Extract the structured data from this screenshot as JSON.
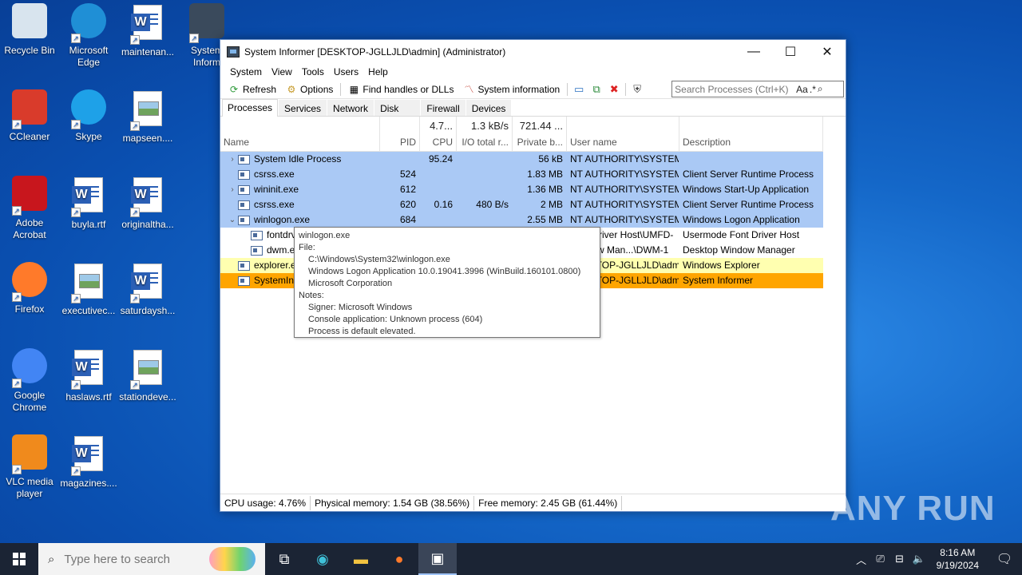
{
  "desktop": {
    "icons": [
      {
        "label": "Recycle Bin",
        "icon": "recycle-bin-icon"
      },
      {
        "label": "Microsoft Edge",
        "icon": "edge-icon"
      },
      {
        "label": "maintenan...",
        "icon": "word-doc-icon"
      },
      {
        "label": "System Inform",
        "icon": "system-informer-icon"
      },
      {
        "label": "CCleaner",
        "icon": "ccleaner-icon"
      },
      {
        "label": "Skype",
        "icon": "skype-icon"
      },
      {
        "label": "mapseen....",
        "icon": "image-doc-icon"
      },
      {
        "label": "Adobe Acrobat",
        "icon": "acrobat-icon"
      },
      {
        "label": "buyla.rtf",
        "icon": "word-doc-icon"
      },
      {
        "label": "originaltha...",
        "icon": "word-doc-icon"
      },
      {
        "label": "Firefox",
        "icon": "firefox-icon"
      },
      {
        "label": "executivec...",
        "icon": "image-doc-icon"
      },
      {
        "label": "saturdaysh...",
        "icon": "word-doc-icon"
      },
      {
        "label": "Google Chrome",
        "icon": "chrome-icon"
      },
      {
        "label": "haslaws.rtf",
        "icon": "word-doc-icon"
      },
      {
        "label": "stationdeve...",
        "icon": "image-doc-icon"
      },
      {
        "label": "VLC media player",
        "icon": "vlc-icon"
      },
      {
        "label": "magazines....",
        "icon": "word-doc-icon"
      }
    ]
  },
  "window": {
    "title": "System Informer [DESKTOP-JGLLJLD\\admin] (Administrator)",
    "menu": [
      "System",
      "View",
      "Tools",
      "Users",
      "Help"
    ],
    "toolbar": {
      "refresh": "Refresh",
      "options": "Options",
      "find": "Find handles or DLLs",
      "sysinfo": "System information",
      "search_placeholder": "Search Processes (Ctrl+K)",
      "search_aa": "Aa",
      "search_regex": ".*"
    },
    "tabs": [
      "Processes",
      "Services",
      "Network",
      "Disk",
      "Firewall",
      "Devices"
    ],
    "columns": {
      "name": "Name",
      "pid": "PID",
      "cpu": "CPU",
      "cpu_total": "4.7...",
      "io": "I/O total r...",
      "io_total": "1.3 kB/s",
      "priv": "Private b...",
      "priv_total": "721.44 ...",
      "user": "User name",
      "desc": "Description"
    },
    "rows": [
      {
        "name": "System Idle Process",
        "pid": "",
        "cpu": "95.24",
        "io": "",
        "priv": "56 kB",
        "user": "NT AUTHORITY\\SYSTEM",
        "desc": "",
        "expander": "›",
        "style": "sys",
        "indent": 0
      },
      {
        "name": "csrss.exe",
        "pid": "524",
        "cpu": "",
        "io": "",
        "priv": "1.83 MB",
        "user": "NT AUTHORITY\\SYSTEM",
        "desc": "Client Server Runtime Process",
        "expander": "",
        "style": "sys",
        "indent": 0
      },
      {
        "name": "wininit.exe",
        "pid": "612",
        "cpu": "",
        "io": "",
        "priv": "1.36 MB",
        "user": "NT AUTHORITY\\SYSTEM",
        "desc": "Windows Start-Up Application",
        "expander": "›",
        "style": "sys",
        "indent": 0
      },
      {
        "name": "csrss.exe",
        "pid": "620",
        "cpu": "0.16",
        "io": "480 B/s",
        "priv": "2 MB",
        "user": "NT AUTHORITY\\SYSTEM",
        "desc": "Client Server Runtime Process",
        "expander": "",
        "style": "sys",
        "indent": 0
      },
      {
        "name": "winlogon.exe",
        "pid": "684",
        "cpu": "",
        "io": "",
        "priv": "2.55 MB",
        "user": "NT AUTHORITY\\SYSTEM",
        "desc": "Windows Logon Application",
        "expander": "⌄",
        "style": "sys",
        "indent": 0
      },
      {
        "name": "fontdrvhost.exe",
        "pid": "",
        "cpu": "",
        "io": "",
        "priv": "",
        "user": "Font Driver Host\\UMFD-",
        "desc": "Usermode Font Driver Host",
        "expander": "",
        "style": "svc",
        "indent": 1
      },
      {
        "name": "dwm.exe",
        "pid": "",
        "cpu": "",
        "io": "",
        "priv": "",
        "user": "Window Man...\\DWM-1",
        "desc": "Desktop Window Manager",
        "expander": "",
        "style": "svc",
        "indent": 1
      },
      {
        "name": "explorer.exe",
        "pid": "",
        "cpu": "",
        "io": "",
        "priv": "",
        "user": "DESKTOP-JGLLJLD\\admi",
        "desc": "Windows Explorer",
        "expander": "",
        "style": "exp",
        "indent": 0
      },
      {
        "name": "SystemInformer.exe",
        "pid": "",
        "cpu": "",
        "io": "",
        "priv": "",
        "user": "DESKTOP-JGLLJLD\\admi",
        "desc": "System Informer",
        "expander": "",
        "style": "self",
        "indent": 0
      }
    ],
    "tooltip": {
      "line1": "winlogon.exe",
      "file_label": "File:",
      "path": "C:\\Windows\\System32\\winlogon.exe",
      "version": "Windows Logon Application 10.0.19041.3996 (WinBuild.160101.0800)",
      "company": "Microsoft Corporation",
      "notes_label": "Notes:",
      "signer": "Signer: Microsoft Windows",
      "console": "Console application: Unknown process (604)",
      "elevated": "Process is default elevated."
    },
    "status": {
      "cpu": "CPU usage: 4.76%",
      "phys": "Physical memory: 1.54 GB (38.56%)",
      "free": "Free memory: 2.45 GB (61.44%)"
    }
  },
  "watermark": "ANY RUN",
  "taskbar": {
    "search_placeholder": "Type here to search",
    "time": "8:16 AM",
    "date": "9/19/2024"
  }
}
